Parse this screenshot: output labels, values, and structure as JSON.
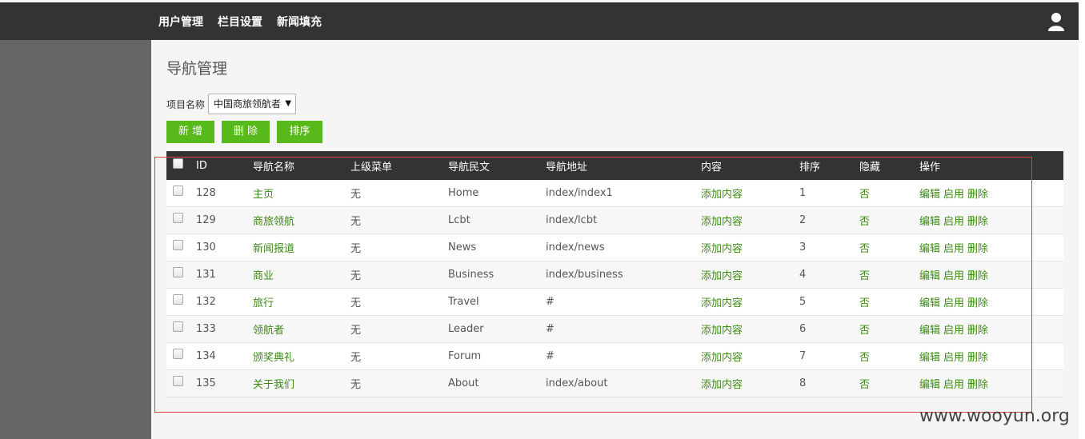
{
  "topnav": [
    "用户管理",
    "栏目设置",
    "新闻填充"
  ],
  "page_title": "导航管理",
  "project": {
    "label": "项目名称",
    "selected": "中国商旅领航者",
    "arrow": "▼"
  },
  "buttons": {
    "add": "新 增",
    "delete": "删 除",
    "sort": "排序"
  },
  "columns": [
    "ID",
    "导航名称",
    "上级菜单",
    "导航民文",
    "导航地址",
    "内容",
    "排序",
    "隐藏",
    "操作"
  ],
  "rows": [
    {
      "id": "128",
      "name": "主页",
      "parent": "无",
      "en": "Home",
      "url": "index/index1",
      "content": "添加内容",
      "order": "1",
      "hidden": "否"
    },
    {
      "id": "129",
      "name": "商旅领航",
      "parent": "无",
      "en": "Lcbt",
      "url": "index/lcbt",
      "content": "添加内容",
      "order": "2",
      "hidden": "否"
    },
    {
      "id": "130",
      "name": "新闻报道",
      "parent": "无",
      "en": "News",
      "url": "index/news",
      "content": "添加内容",
      "order": "3",
      "hidden": "否"
    },
    {
      "id": "131",
      "name": "商业",
      "parent": "无",
      "en": "Business",
      "url": "index/business",
      "content": "添加内容",
      "order": "4",
      "hidden": "否"
    },
    {
      "id": "132",
      "name": "旅行",
      "parent": "无",
      "en": "Travel",
      "url": "#",
      "content": "添加内容",
      "order": "5",
      "hidden": "否"
    },
    {
      "id": "133",
      "name": "领航者",
      "parent": "无",
      "en": "Leader",
      "url": "#",
      "content": "添加内容",
      "order": "6",
      "hidden": "否"
    },
    {
      "id": "134",
      "name": "颁奖典礼",
      "parent": "无",
      "en": "Forum",
      "url": "#",
      "content": "添加内容",
      "order": "7",
      "hidden": "否"
    },
    {
      "id": "135",
      "name": "关于我们",
      "parent": "无",
      "en": "About",
      "url": "index/about",
      "content": "添加内容",
      "order": "8",
      "hidden": "否"
    }
  ],
  "row_actions": {
    "edit": "编辑",
    "enable": "启用",
    "delete": "删除"
  },
  "watermark": "www.wooyun.org",
  "colors": {
    "topbar": "#333333",
    "sidebar": "#666666",
    "accent_green": "#57b91a",
    "link_green": "#3c8a16",
    "highlight_box": "#e03c3c"
  },
  "icons": {
    "user": "user-icon",
    "select_arrow": "chevron-down-icon"
  }
}
